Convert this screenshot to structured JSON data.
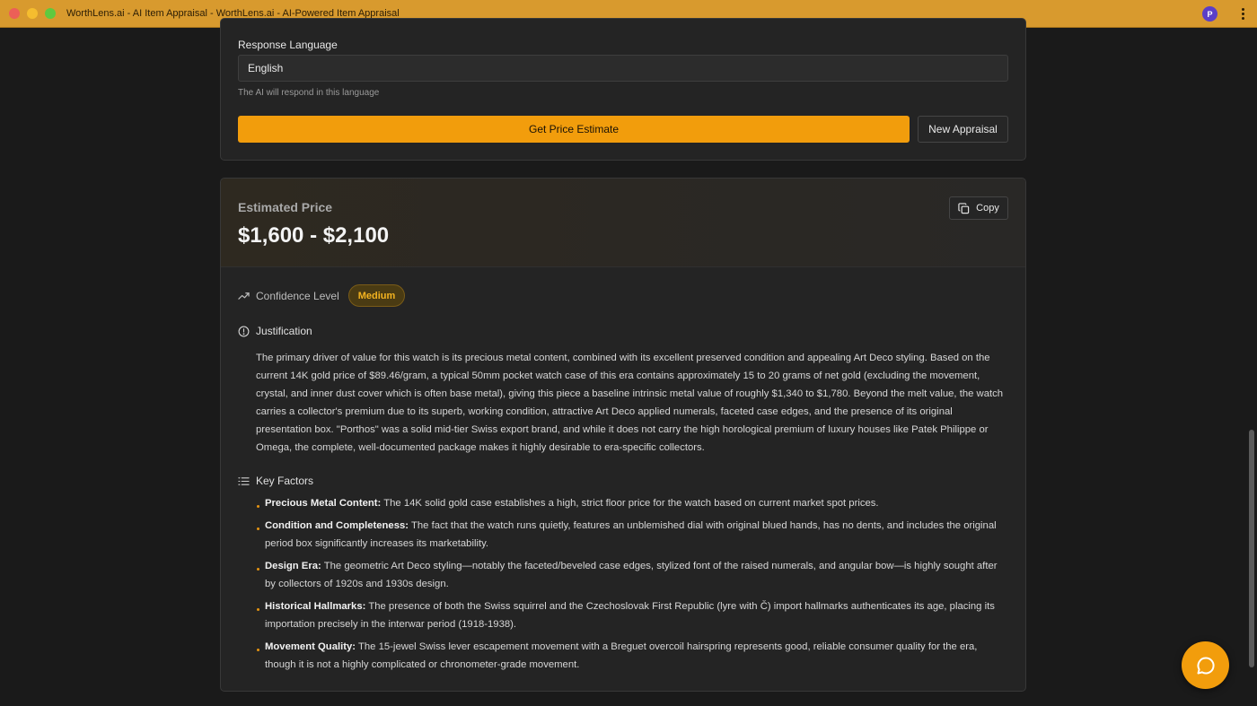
{
  "window": {
    "title": "WorthLens.ai - AI Item Appraisal - WorthLens.ai - AI-Powered Item Appraisal",
    "profile_initial": "P"
  },
  "form": {
    "language_label": "Response Language",
    "language_value": "English",
    "language_help": "The AI will respond in this language",
    "estimate_button": "Get Price Estimate",
    "new_button": "New Appraisal"
  },
  "result": {
    "price_label": "Estimated Price",
    "price_value": "$1,600 - $2,100",
    "copy_button": "Copy",
    "confidence_label": "Confidence Level",
    "confidence_value": "Medium",
    "justification_title": "Justification",
    "justification_text": "The primary driver of value for this watch is its precious metal content, combined with its excellent preserved condition and appealing Art Deco styling. Based on the current 14K gold price of $89.46/gram, a typical 50mm pocket watch case of this era contains approximately 15 to 20 grams of net gold (excluding the movement, crystal, and inner dust cover which is often base metal), giving this piece a baseline intrinsic metal value of roughly $1,340 to $1,780. Beyond the melt value, the watch carries a collector's premium due to its superb, working condition, attractive Art Deco applied numerals, faceted case edges, and the presence of its original presentation box. \"Porthos\" was a solid mid-tier Swiss export brand, and while it does not carry the high horological premium of luxury houses like Patek Philippe or Omega, the complete, well-documented package makes it highly desirable to era-specific collectors.",
    "factors_title": "Key Factors",
    "factors": [
      {
        "title": "Precious Metal Content:",
        "text": " The 14K solid gold case establishes a high, strict floor price for the watch based on current market spot prices."
      },
      {
        "title": "Condition and Completeness:",
        "text": " The fact that the watch runs quietly, features an unblemished dial with original blued hands, has no dents, and includes the original period box significantly increases its marketability."
      },
      {
        "title": "Design Era:",
        "text": " The geometric Art Deco styling—notably the faceted/beveled case edges, stylized font of the raised numerals, and angular bow—is highly sought after by collectors of 1920s and 1930s design."
      },
      {
        "title": "Historical Hallmarks:",
        "text": " The presence of both the Swiss squirrel and the Czechoslovak First Republic (lyre with Č) import hallmarks authenticates its age, placing its importation precisely in the interwar period (1918-1938)."
      },
      {
        "title": "Movement Quality:",
        "text": " The 15-jewel Swiss lever escapement movement with a Breguet overcoil hairspring represents good, reliable consumer quality for the era, though it is not a highly complicated or chronometer-grade movement."
      }
    ]
  },
  "icons": {
    "copy": "copy-icon",
    "trend": "trending-up-icon",
    "info": "info-circle-icon",
    "list": "list-icon",
    "chat": "chat-bubble-icon"
  },
  "colors": {
    "accent": "#f29d0c",
    "titlebar": "#d89a2e",
    "badge_text": "#f3b320",
    "background": "#1a1a1a",
    "card": "#242424"
  }
}
